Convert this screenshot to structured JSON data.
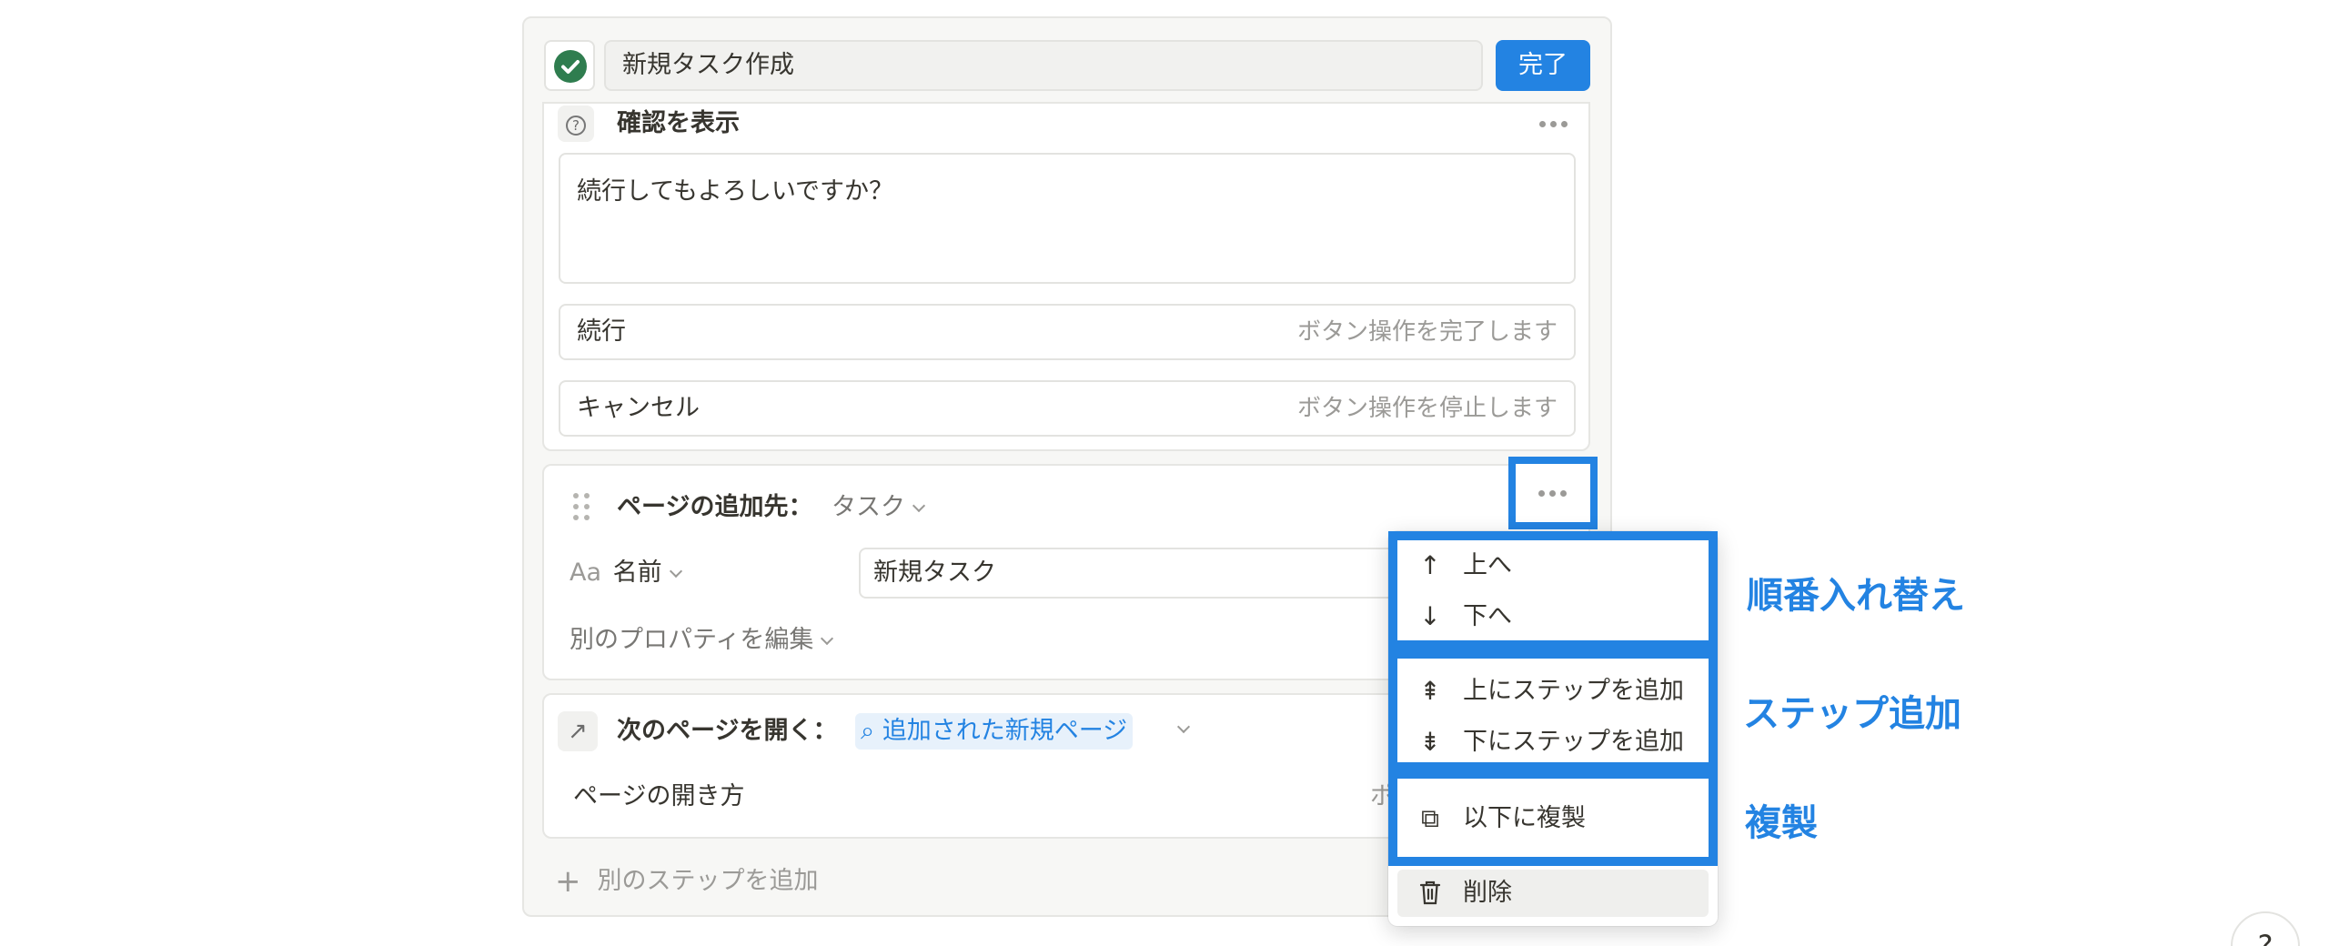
{
  "header": {
    "title_value": "新規タスク作成",
    "done_label": "完了"
  },
  "confirm_step": {
    "title": "確認を表示",
    "message": "続行してもよろしいですか？",
    "options": [
      {
        "label": "続行",
        "hint": "ボタン操作を完了します"
      },
      {
        "label": "キャンセル",
        "hint": "ボタン操作を停止します"
      }
    ]
  },
  "add_page_step": {
    "title": "ページの追加先：",
    "target": "タスク",
    "property_icon": "Aa",
    "property_name": "名前",
    "property_value": "新規タスク",
    "edit_other": "別のプロパティを編集"
  },
  "open_page_step": {
    "title": "次のページを開く：",
    "link_label": "追加された新規ページ",
    "open_method_label": "ページの開き方",
    "open_method_value_partial": "ポ"
  },
  "add_step_label": "別のステップを追加",
  "menu": {
    "items": [
      {
        "label": "上へ",
        "icon": "arrow-up-icon"
      },
      {
        "label": "下へ",
        "icon": "arrow-down-icon"
      },
      {
        "label": "上にステップを追加",
        "icon": "insert-above-icon"
      },
      {
        "label": "下にステップを追加",
        "icon": "insert-below-icon"
      },
      {
        "label": "以下に複製",
        "icon": "duplicate-icon"
      },
      {
        "label": "削除",
        "icon": "trash-icon"
      }
    ]
  },
  "annotations": {
    "reorder": "順番入れ替え",
    "add_step": "ステップ追加",
    "duplicate": "複製"
  },
  "help_label": "?",
  "colors": {
    "accent": "#2383e2",
    "check_green": "#2f7d4f"
  }
}
